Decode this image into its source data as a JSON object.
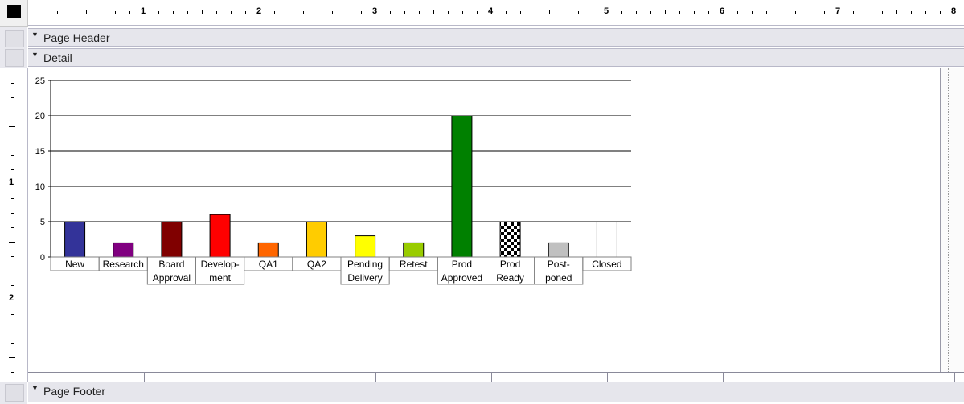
{
  "ruler": {
    "numbers": [
      "1",
      "2",
      "3",
      "4",
      "5",
      "6",
      "7",
      "8"
    ],
    "vertical_numbers": [
      "1",
      "2"
    ]
  },
  "sections": {
    "page_header": "Page Header",
    "detail": "Detail",
    "page_footer": "Page Footer"
  },
  "chart_data": {
    "type": "bar",
    "categories": [
      [
        "New"
      ],
      [
        "Research"
      ],
      [
        "Board",
        "Approval"
      ],
      [
        "Develop-",
        "ment"
      ],
      [
        "QA1"
      ],
      [
        "QA2"
      ],
      [
        "Pending",
        "Delivery"
      ],
      [
        "Retest"
      ],
      [
        "Prod",
        "Approved"
      ],
      [
        "Prod",
        "Ready"
      ],
      [
        "Post-",
        "poned"
      ],
      [
        "Closed"
      ]
    ],
    "values": [
      5,
      2,
      5,
      6,
      2,
      5,
      3,
      2,
      20,
      5,
      2,
      5
    ],
    "colors": [
      "#333399",
      "#800080",
      "#800000",
      "#ff0000",
      "#ff6600",
      "#ffcc00",
      "#ffff00",
      "#99cc00",
      "#008000",
      "checker",
      "#c0c0c0",
      "#ffffff"
    ],
    "ylim": [
      0,
      25
    ],
    "yticks": [
      "0",
      "5",
      "10",
      "15",
      "20",
      "25"
    ],
    "grid": true
  }
}
